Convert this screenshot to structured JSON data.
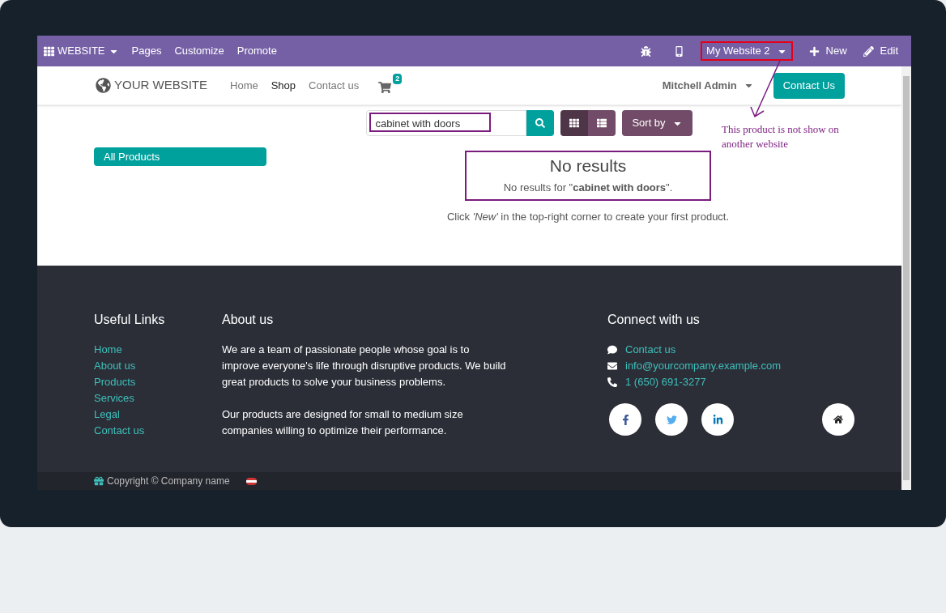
{
  "admin_bar": {
    "app_menu": "WEBSITE",
    "menu": [
      "Pages",
      "Customize",
      "Promote"
    ],
    "website_switcher": "My Website 2",
    "new": "New",
    "edit": "Edit"
  },
  "navbar": {
    "logo": "YOUR WEBSITE",
    "links": [
      {
        "label": "Home",
        "selected": false
      },
      {
        "label": "Shop",
        "selected": true
      },
      {
        "label": "Contact us",
        "selected": false
      }
    ],
    "cart_count": "2",
    "user": "Mitchell Admin",
    "cta": "Contact Us"
  },
  "annotation": {
    "note": "This product is not show on another website"
  },
  "shop": {
    "search_value": "cabinet with doors",
    "view_modes": [
      {
        "kind": "grid",
        "selected": true
      },
      {
        "kind": "list",
        "selected": false
      }
    ],
    "sort": "Sort by",
    "categories": [
      {
        "label": "All Products",
        "selected": true
      }
    ],
    "empty_title": "No results",
    "empty_message": "No results for \"**cabinet with doors**\".",
    "hint": "Click *'New'* in the top-right corner to create your first product."
  },
  "footer": {
    "useful_links_title": "Useful Links",
    "useful_links": [
      "Home",
      "About us",
      "Products",
      "Services",
      "Legal",
      "Contact us"
    ],
    "about_title": "About us",
    "about_paragraphs": [
      "We are a team of passionate people whose goal is to improve everyone's life through disruptive products. We build great products to solve your business problems.",
      "Our products are designed for small to medium size companies willing to optimize their performance."
    ],
    "connect_title": "Connect with us",
    "contacts": [
      {
        "kind": "chat",
        "text": "Contact us"
      },
      {
        "kind": "mail",
        "text": "info@yourcompany.example.com"
      },
      {
        "kind": "phone",
        "text": "1 (650) 691-3277"
      }
    ],
    "social": [
      {
        "kind": "facebook"
      },
      {
        "kind": "twitter"
      },
      {
        "kind": "linkedin"
      }
    ],
    "copyright": "Copyright © Company name"
  }
}
